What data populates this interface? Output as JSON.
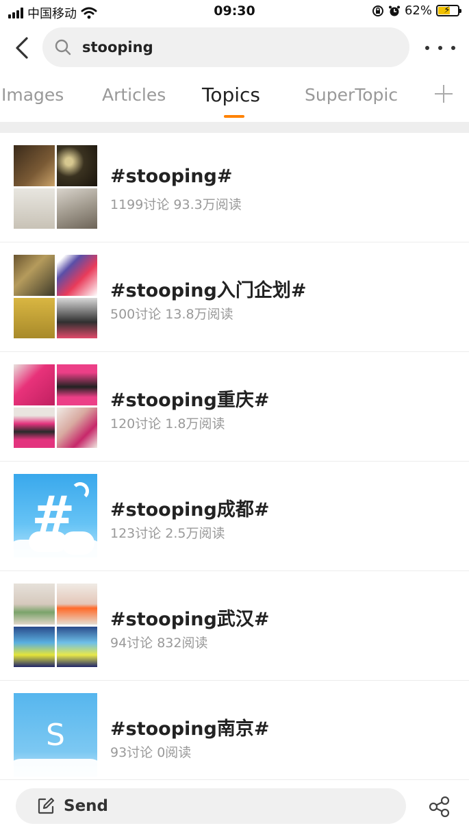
{
  "status_bar": {
    "carrier": "中国移动",
    "time": "09:30",
    "battery_percent": "62%",
    "battery_level": 0.62,
    "icons": [
      "signal-icon",
      "wifi-icon",
      "lock-rotation-icon",
      "alarm-icon",
      "battery-icon"
    ]
  },
  "search": {
    "query": "stooping"
  },
  "tabs": [
    {
      "label": "Images",
      "active": false
    },
    {
      "label": "Articles",
      "active": false
    },
    {
      "label": "Topics",
      "active": true
    },
    {
      "label": "SuperTopic",
      "active": false
    }
  ],
  "topics": [
    {
      "title": "#stooping#",
      "stats": "1199讨论 93.3万阅读"
    },
    {
      "title": "#stooping入门企划#",
      "stats": "500讨论 13.8万阅读"
    },
    {
      "title": "#stooping重庆#",
      "stats": "120讨论 1.8万阅读"
    },
    {
      "title": "#stooping成都#",
      "stats": "123讨论 2.5万阅读"
    },
    {
      "title": "#stooping武汉#",
      "stats": "94讨论 832阅读"
    },
    {
      "title": "#stooping南京#",
      "stats": "93讨论 0阅读"
    }
  ],
  "thumb_s_letter": "S",
  "bottom": {
    "send_label": "Send"
  },
  "colors": {
    "accent": "#ff8200",
    "muted_text": "#999999",
    "band": "#eeeeee"
  }
}
